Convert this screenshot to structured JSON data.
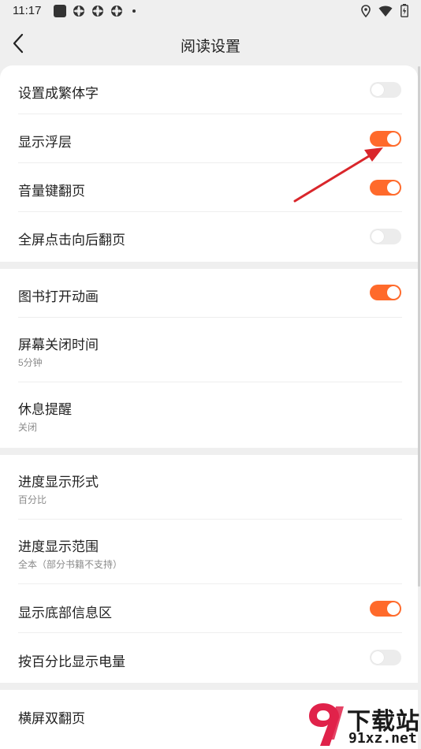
{
  "status_bar": {
    "time": "11:17"
  },
  "header": {
    "title": "阅读设置"
  },
  "settings": {
    "group1": [
      {
        "label": "设置成繁体字",
        "toggle": "off"
      },
      {
        "label": "显示浮层",
        "toggle": "on"
      },
      {
        "label": "音量键翻页",
        "toggle": "on"
      },
      {
        "label": "全屏点击向后翻页",
        "toggle": "off"
      }
    ],
    "group2": [
      {
        "label": "图书打开动画",
        "toggle": "on"
      },
      {
        "label": "屏幕关闭时间",
        "sub": "5分钟"
      },
      {
        "label": "休息提醒",
        "sub": "关闭"
      }
    ],
    "group3": [
      {
        "label": "进度显示形式",
        "sub": "百分比"
      },
      {
        "label": "进度显示范围",
        "sub": "全本（部分书籍不支持）"
      },
      {
        "label": "显示底部信息区",
        "toggle": "on"
      },
      {
        "label": "按百分比显示电量",
        "toggle": "off"
      }
    ],
    "group4": [
      {
        "label": "横屏双翻页"
      }
    ]
  },
  "watermark": {
    "title": "下载站",
    "url": "91xz.net"
  },
  "colors": {
    "accent": "#ff6a2b",
    "toggle_off": "#ececec",
    "annotation_arrow": "#d9262b"
  }
}
